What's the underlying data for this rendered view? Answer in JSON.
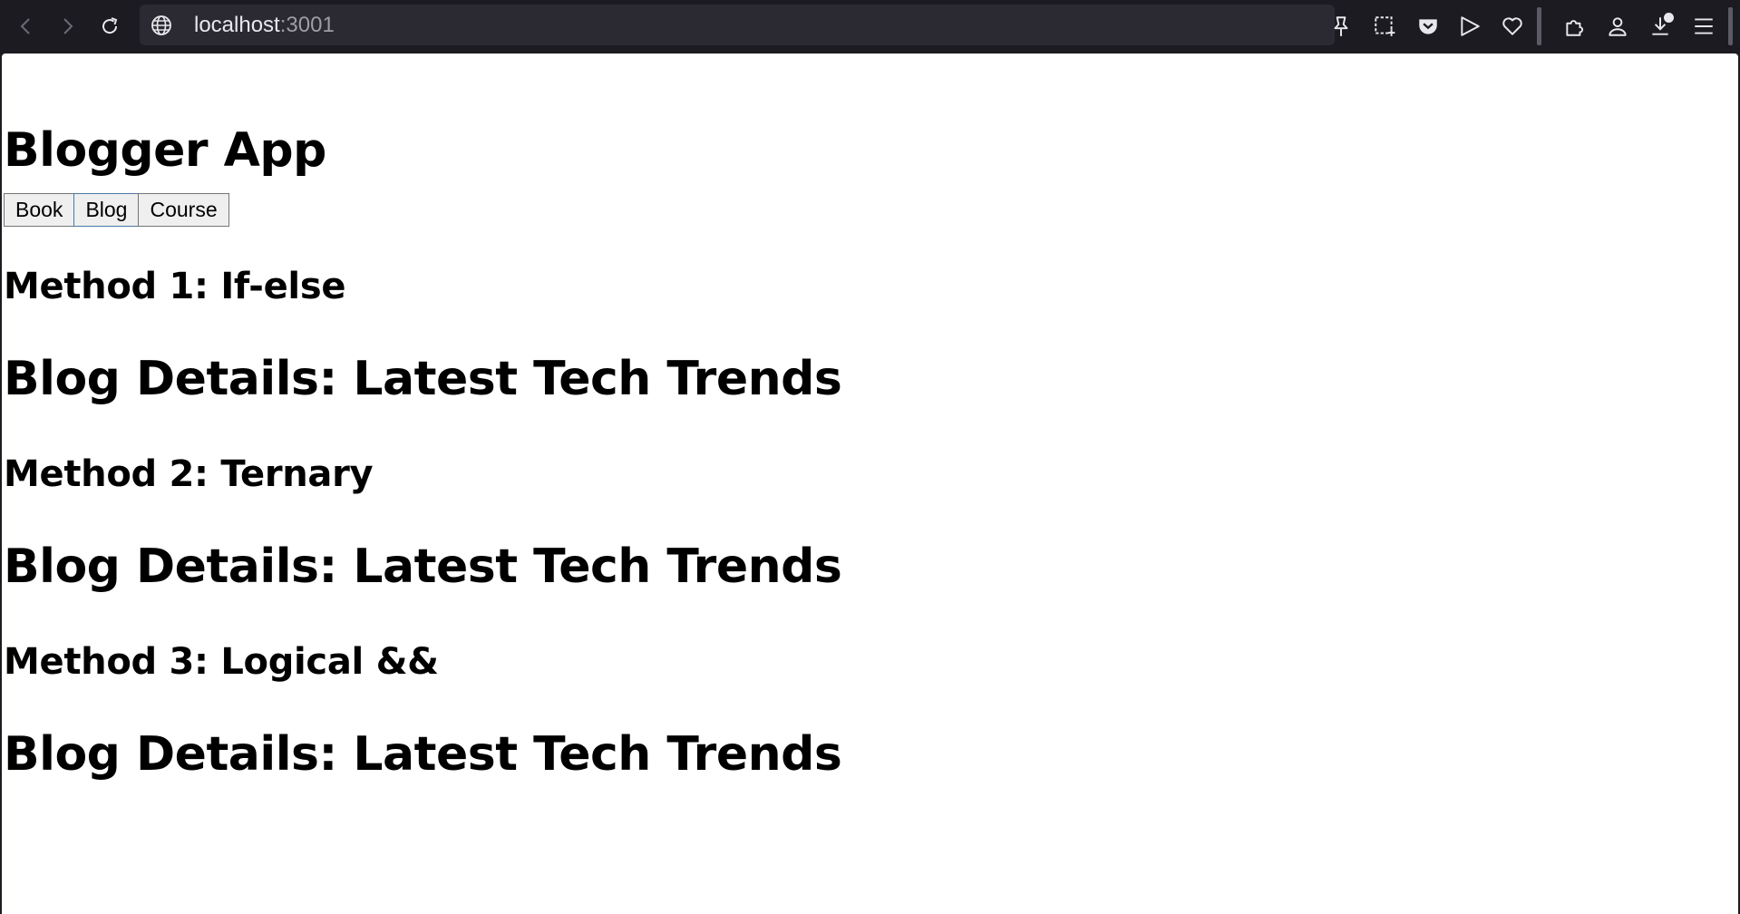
{
  "browser": {
    "url_host": "localhost",
    "url_port": ":3001",
    "icons": [
      "back-icon",
      "forward-icon",
      "reload-icon",
      "globe-icon",
      "pin-icon",
      "screenshot-icon",
      "pocket-icon",
      "send-icon",
      "heart-icon",
      "extensions-icon",
      "account-icon",
      "downloads-icon",
      "menu-icon"
    ]
  },
  "app": {
    "title": "Blogger App",
    "buttons": [
      {
        "label": "Book"
      },
      {
        "label": "Blog"
      },
      {
        "label": "Course"
      }
    ],
    "sections": [
      {
        "method": "Method 1: If-else",
        "detail": "Blog Details: Latest Tech Trends"
      },
      {
        "method": "Method 2: Ternary",
        "detail": "Blog Details: Latest Tech Trends"
      },
      {
        "method": "Method 3: Logical &&",
        "detail": "Blog Details: Latest Tech Trends"
      }
    ]
  }
}
